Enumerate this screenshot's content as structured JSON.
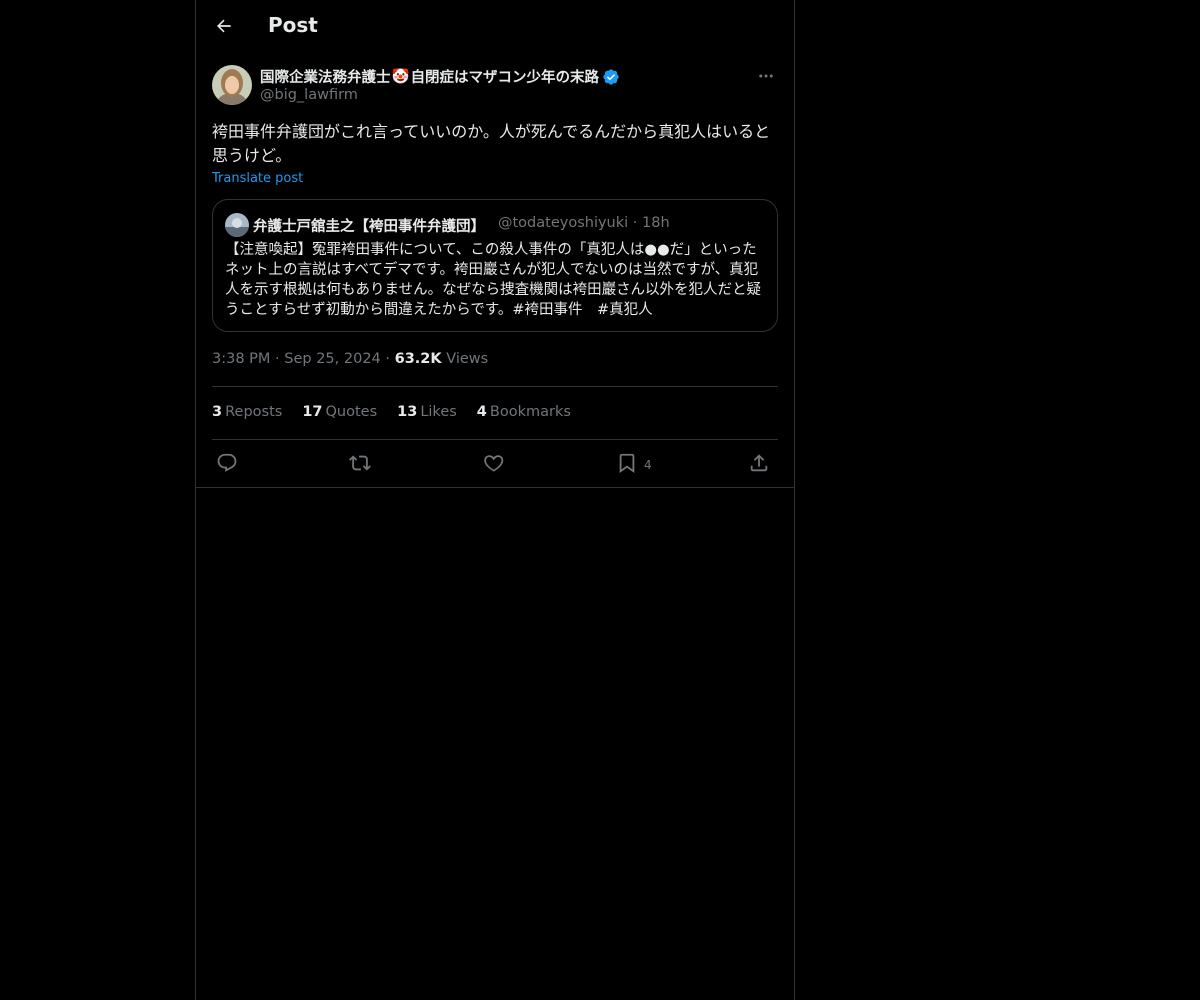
{
  "header": {
    "title": "Post"
  },
  "author": {
    "display_name": "国際企業法務弁護士",
    "name_emoji": "🤡",
    "display_name_suffix": "自閉症はマザコン少年の末路",
    "handle": "@big_lawfirm",
    "verified": true
  },
  "post": {
    "text": "袴田事件弁護団がこれ言っていいのか。人が死んでるんだから真犯人はいると思うけど。",
    "translate_label": "Translate post",
    "time": "3:38 PM",
    "date": "Sep 25, 2024",
    "views_count": "63.2K",
    "views_label": "Views",
    "separator": "·"
  },
  "quote": {
    "name": "弁護士戸舘圭之【袴田事件弁護団】",
    "handle": "@todateyoshiyuki",
    "age": "18h",
    "text": "【注意喚起】冤罪袴田事件について、この殺人事件の「真犯人は●●だ」といったネット上の言説はすべてデマです。袴田巖さんが犯人でないのは当然ですが、真犯人を示す根拠は何もありません。なぜなら捜査機関は袴田巖さん以外を犯人だと疑うことすらせず初動から間違えたからです。#袴田事件　#真犯人"
  },
  "stats": {
    "reposts_count": "3",
    "reposts_label": "Reposts",
    "quotes_count": "17",
    "quotes_label": "Quotes",
    "likes_count": "13",
    "likes_label": "Likes",
    "bookmarks_count": "4",
    "bookmarks_label": "Bookmarks"
  },
  "actions": {
    "bookmark_count": "4"
  },
  "colors": {
    "accent": "#1d9bf0",
    "muted": "#71767b",
    "text": "#e7e9ea",
    "border": "#2f3336"
  }
}
